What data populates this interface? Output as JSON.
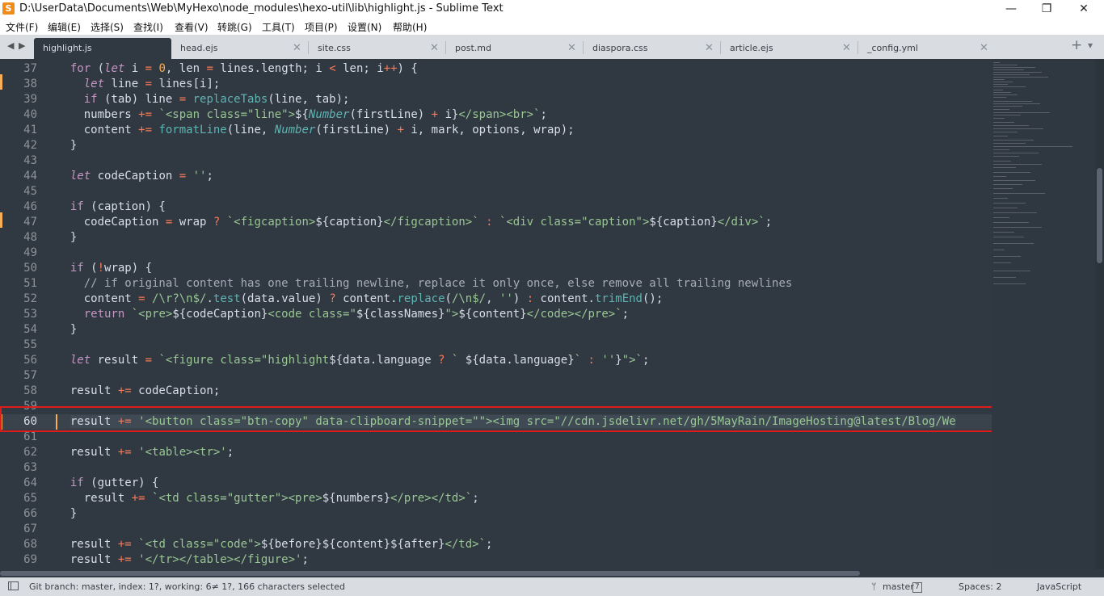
{
  "window": {
    "title": "D:\\UserData\\Documents\\Web\\MyHexo\\node_modules\\hexo-util\\lib\\highlight.js - Sublime Text",
    "minimize_glyph": "—",
    "maximize_glyph": "❐",
    "close_glyph": "✕"
  },
  "menu": [
    "文件(F)",
    "编辑(E)",
    "选择(S)",
    "查找(I)",
    "查看(V)",
    "转跳(G)",
    "工具(T)",
    "项目(P)",
    "设置(N)",
    "帮助(H)"
  ],
  "tabs": [
    {
      "label": "highlight.js",
      "active": true
    },
    {
      "label": "head.ejs"
    },
    {
      "label": "site.css"
    },
    {
      "label": "post.md"
    },
    {
      "label": "diaspora.css"
    },
    {
      "label": "article.ejs"
    },
    {
      "label": "_config.yml"
    }
  ],
  "tab_nav": {
    "left": "◀",
    "right": "▶",
    "new_tab": "+",
    "tab_list": "▾",
    "close": "✕"
  },
  "editor": {
    "line_numbers": [
      "37",
      "38",
      "39",
      "40",
      "41",
      "42",
      "43",
      "44",
      "45",
      "46",
      "47",
      "48",
      "49",
      "50",
      "51",
      "52",
      "53",
      "54",
      "55",
      "56",
      "57",
      "58",
      "59",
      "60",
      "61",
      "62",
      "63",
      "64",
      "65",
      "66",
      "67",
      "68",
      "69"
    ],
    "active_line": "60",
    "modified_lines": [
      "38",
      "46",
      "60"
    ]
  },
  "status": {
    "git": "Git branch: master, index: 1?, working: 6≠ 1?, 166 characters selected",
    "branch": "master",
    "branch_badge": "7",
    "spaces": "Spaces: 2",
    "syntax": "JavaScript"
  },
  "colors": {
    "editor_bg": "#303841",
    "keyword": "#c695c6",
    "operator": "#f97b58",
    "string": "#99c794",
    "number": "#f9ae58",
    "function": "#5fb4b4",
    "comment": "#a6acb9",
    "highlight_box": "#e01b1b"
  }
}
